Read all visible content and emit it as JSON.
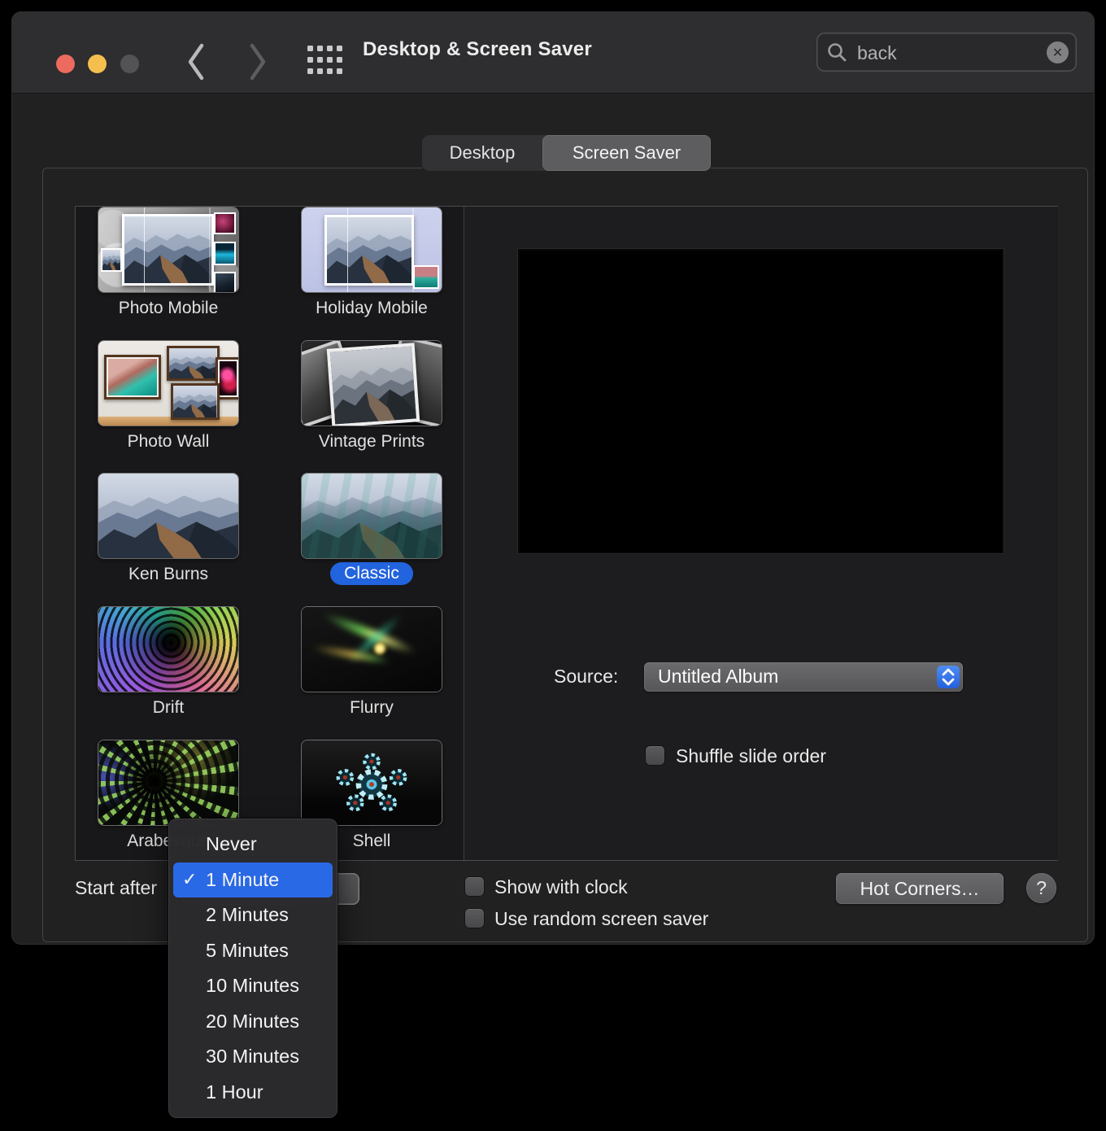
{
  "window": {
    "title": "Desktop & Screen Saver",
    "search_value": "back"
  },
  "tabs": [
    {
      "label": "Desktop",
      "selected": false
    },
    {
      "label": "Screen Saver",
      "selected": true
    }
  ],
  "savers": [
    {
      "name": "Photo Mobile",
      "art": "photo-mobile",
      "selected": false
    },
    {
      "name": "Holiday Mobile",
      "art": "holiday-mobile",
      "selected": false
    },
    {
      "name": "Photo Wall",
      "art": "photo-wall",
      "selected": false
    },
    {
      "name": "Vintage Prints",
      "art": "vintage-prints",
      "selected": false
    },
    {
      "name": "Ken Burns",
      "art": "ken-burns",
      "selected": false
    },
    {
      "name": "Classic",
      "art": "classic",
      "selected": true
    },
    {
      "name": "Drift",
      "art": "drift",
      "selected": false
    },
    {
      "name": "Flurry",
      "art": "flurry",
      "selected": false
    },
    {
      "name": "Arabesque",
      "art": "arabesque",
      "selected": false
    },
    {
      "name": "Shell",
      "art": "shell",
      "selected": false
    }
  ],
  "detail": {
    "source_label": "Source:",
    "source_value": "Untitled Album",
    "shuffle_label": "Shuffle slide order"
  },
  "footer": {
    "start_after_label": "Start after",
    "show_with_clock_label": "Show with clock",
    "use_random_label": "Use random screen saver",
    "hot_corners_label": "Hot Corners…",
    "help_label": "?"
  },
  "start_after_menu": {
    "items": [
      {
        "label": "Never",
        "checked": false,
        "selected": false
      },
      {
        "label": "1 Minute",
        "checked": true,
        "selected": true
      },
      {
        "label": "2 Minutes",
        "checked": false,
        "selected": false
      },
      {
        "label": "5 Minutes",
        "checked": false,
        "selected": false
      },
      {
        "label": "10 Minutes",
        "checked": false,
        "selected": false
      },
      {
        "label": "20 Minutes",
        "checked": false,
        "selected": false
      },
      {
        "label": "30 Minutes",
        "checked": false,
        "selected": false
      },
      {
        "label": "1 Hour",
        "checked": false,
        "selected": false
      }
    ]
  },
  "colors": {
    "accent_blue": "#2a69e5",
    "selection_pill_blue": "#2263de"
  }
}
